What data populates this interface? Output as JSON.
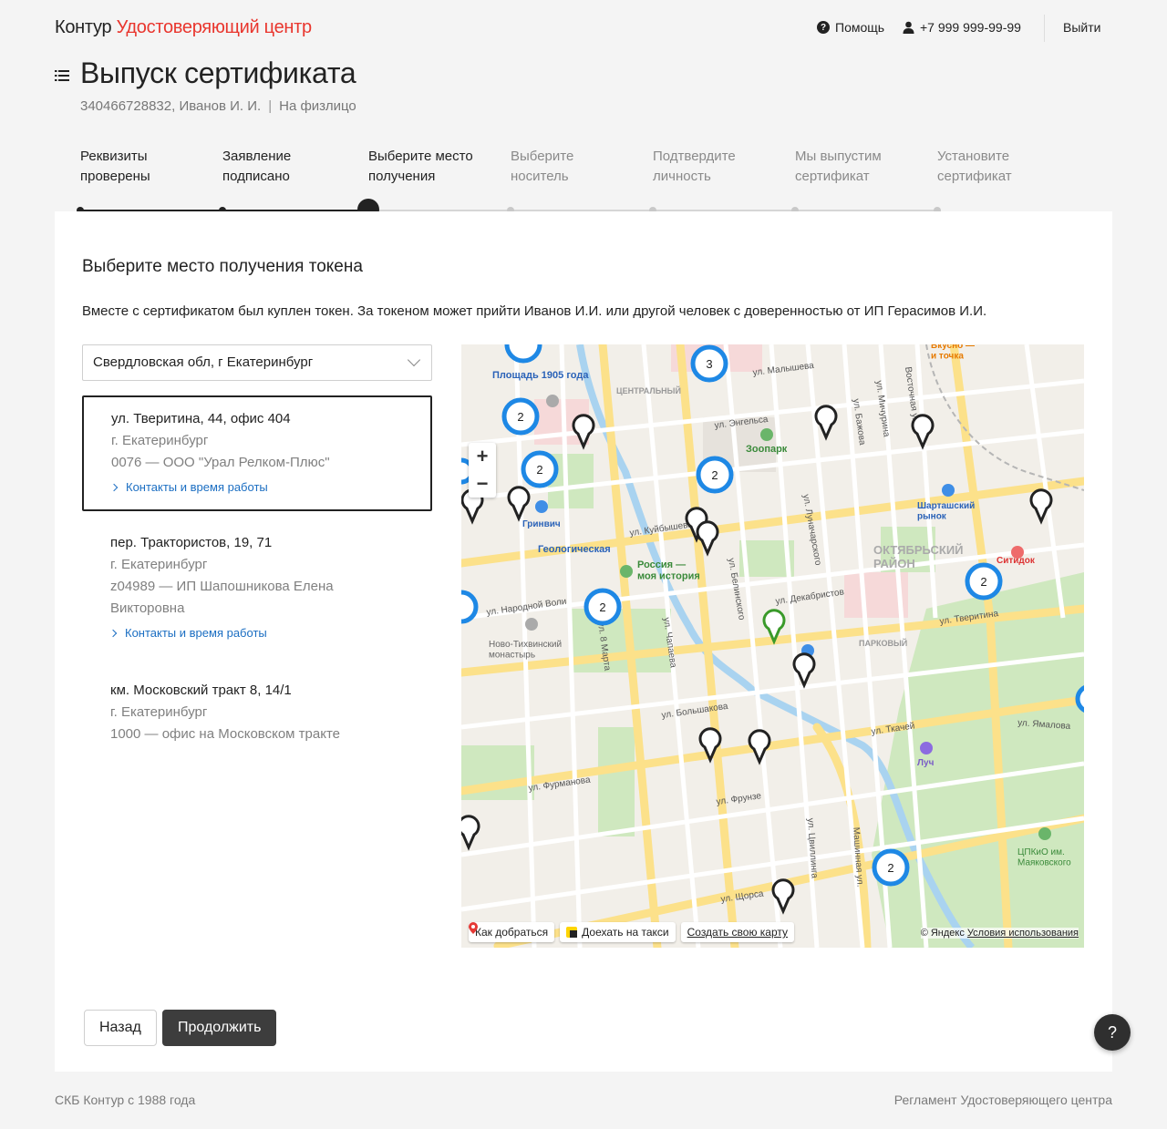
{
  "header": {
    "brand": "Контур",
    "product": "Удостоверяющий центр",
    "help": "Помощь",
    "phone": "+7 999 999-99-99",
    "logout": "Выйти"
  },
  "page": {
    "title": "Выпуск сертификата",
    "subtitle_id": "340466728832, Иванов И. И.",
    "subtitle_sep": "|",
    "subtitle_type": "На физлицо"
  },
  "steps": [
    {
      "line1": "Реквизиты",
      "line2": "проверены",
      "state": "done"
    },
    {
      "line1": "Заявление",
      "line2": "подписано",
      "state": "done"
    },
    {
      "line1": "Выберите место",
      "line2": "получения",
      "state": "current"
    },
    {
      "line1": "Выберите",
      "line2": "носитель",
      "state": "todo"
    },
    {
      "line1": "Подтвердите",
      "line2": "личность",
      "state": "todo"
    },
    {
      "line1": "Мы выпустим",
      "line2": "сертификат",
      "state": "todo"
    },
    {
      "line1": "Установите",
      "line2": "сертификат",
      "state": "todo"
    }
  ],
  "card": {
    "title": "Выберите место получения токена",
    "description": "Вместе с сертификатом был куплен токен. За токеном может прийти Иванов И.И. или другой человек с доверенностью от ИП Герасимов И.И.",
    "region": "Свердловская обл, г Екатеринбург"
  },
  "offices": [
    {
      "address": "ул. Тверитина, 44, офис 404",
      "city": "г. Екатеринбург",
      "org": "0076 — ООО \"Урал Релком-Плюс\"",
      "link": "Контакты и время работы",
      "selected": true
    },
    {
      "address": "пер. Трактористов, 19, 71",
      "city": "г. Екатеринбург",
      "org": "z04989 — ИП Шапошникова Елена Викторовна",
      "link": "Контакты и время работы",
      "selected": false
    },
    {
      "address": "км. Московский тракт 8, 14/1",
      "city": "г. Екатеринбург",
      "org": "1000 — офис на Московском тракте",
      "selected": false
    }
  ],
  "map": {
    "labels": {
      "square": "Площадь 1905 года",
      "center": "ЦЕНТРАЛЬНЫЙ",
      "zoo": "Зоопарк",
      "geo": "Геологическая",
      "russia": "Россия —\nмоя история",
      "district": "ОКТЯБРЬСКИЙ\nРАЙОН",
      "park": "ПАРКОВЫЙ",
      "monastery": "Ново-Тихвинский\nмонастырь",
      "market": "Шарташский\nрынок",
      "citydoc": "Ситидок",
      "luch": "Луч",
      "cpkio": "ЦПКиО им.\nМаяковского",
      "grinvich": "Гринвич",
      "vkusno": "Вкусно —\nи точка"
    },
    "streets": [
      "ул. Малышева",
      "ул. Энгельса",
      "ул. Куйбышева",
      "ул. Декабристов",
      "ул. Народной Воли",
      "ул. Большакова",
      "ул. Фурманова",
      "ул. Фрунзе",
      "ул. Щорса",
      "ул. Ткачей",
      "ул. Тверитина",
      "ул. Луначарского",
      "ул. Белинского",
      "ул. 8 Марта",
      "ул. Чапаева",
      "ул. Бажова",
      "ул. Мичурина",
      "Восточная ул.",
      "Машинная ул.",
      "ул. Цвиллинга",
      "ул. Ямалова"
    ],
    "clusters": [
      "3",
      "2",
      "2",
      "2",
      "2",
      "2",
      "2"
    ],
    "route": "Как добраться",
    "taxi": "Доехать на такси",
    "create": "Создать свою карту",
    "copyright": "© Яндекс",
    "terms": "Условия использования"
  },
  "buttons": {
    "back": "Назад",
    "next": "Продолжить",
    "help_fab": "?"
  },
  "footer": {
    "left": "СКБ Контур с 1988 года",
    "right": "Регламент Удостоверяющего центра"
  }
}
